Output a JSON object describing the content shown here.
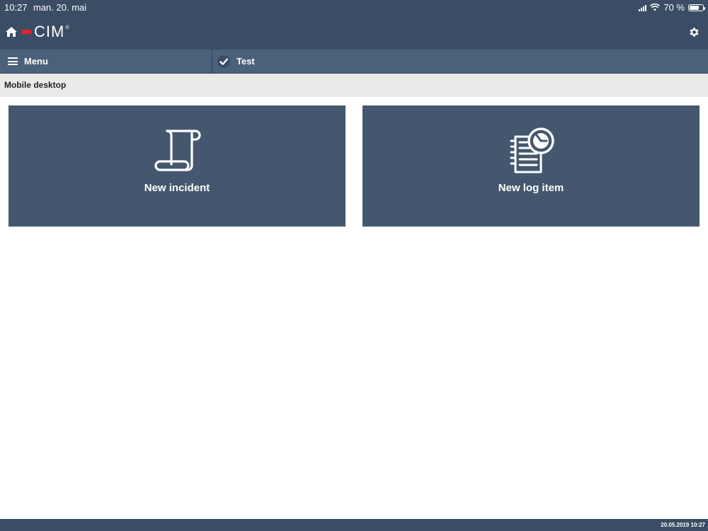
{
  "status_bar": {
    "time": "10:27",
    "date": "man. 20. mai",
    "battery_percent_label": "70 %",
    "battery_level": 0.7,
    "icons": [
      "signal-icon",
      "wifi-icon",
      "battery-icon"
    ]
  },
  "header": {
    "logo_text": "CIM",
    "logo_reg": "®",
    "icons": [
      "home-icon",
      "gear-icon"
    ],
    "colors": {
      "bar": "#3a4d64",
      "logo_accent": "#e2232a"
    }
  },
  "nav": {
    "menu_label": "Menu",
    "test_label": "Test",
    "icons": [
      "hamburger-icon",
      "check-icon"
    ]
  },
  "breadcrumb": {
    "title": "Mobile desktop"
  },
  "tiles": [
    {
      "label": "New incident",
      "icon": "scroll-icon"
    },
    {
      "label": "New log item",
      "icon": "log-clock-icon"
    }
  ],
  "footer": {
    "timestamp": "20.05.2019 10:27"
  }
}
